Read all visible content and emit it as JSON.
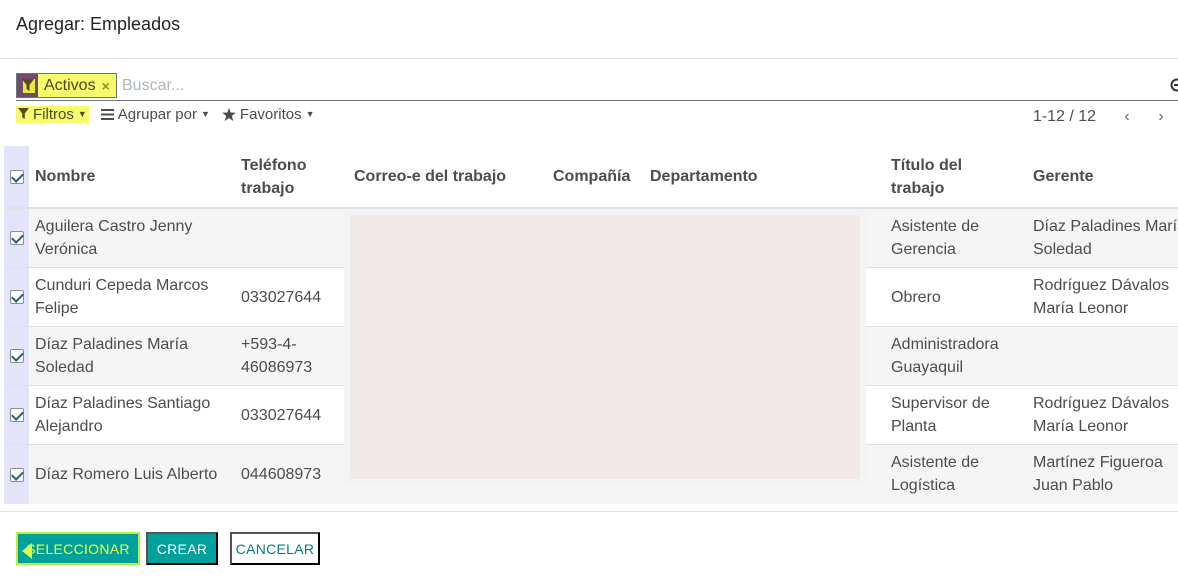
{
  "modal": {
    "title": "Agregar: Empleados"
  },
  "search": {
    "facet_value": "Activos",
    "facet_close": "×",
    "placeholder": "Buscar..."
  },
  "controls": {
    "filters": "Filtros",
    "group_by": "Agrupar por",
    "favorites": "Favoritos"
  },
  "pager": {
    "value": "1-12 / 12",
    "prev": "‹",
    "next": "›"
  },
  "table": {
    "columns": [
      "Nombre",
      "Teléfono trabajo",
      "Correo-e del trabajo",
      "Compañía",
      "Departamento",
      "Título del trabajo",
      "Gerente"
    ],
    "rows": [
      {
        "nombre": "Aguilera Castro Jenny Verónica",
        "telefono": "",
        "titulo": "Asistente de Gerencia",
        "gerente": "Díaz Paladines María Soledad"
      },
      {
        "nombre": "Cunduri Cepeda Marcos Felipe",
        "telefono": "033027644",
        "titulo": "Obrero",
        "gerente": "Rodríguez Dávalos María Leonor"
      },
      {
        "nombre": "Díaz Paladines María Soledad",
        "telefono": "+593-4-46086973",
        "titulo": "Administradora Guayaquil",
        "gerente": ""
      },
      {
        "nombre": "Díaz Paladines Santiago Alejandro",
        "telefono": "033027644",
        "titulo": "Supervisor de Planta",
        "gerente": "Rodríguez Dávalos María Leonor"
      },
      {
        "nombre": "Díaz Romero Luis Alberto",
        "telefono": "044608973",
        "titulo": "Asistente de Logística",
        "gerente": "Martínez Figueroa Juan Pablo"
      }
    ]
  },
  "footer": {
    "select_label": "SELECCIONAR",
    "create_label": "CREAR",
    "cancel_label": "CANCELAR"
  }
}
